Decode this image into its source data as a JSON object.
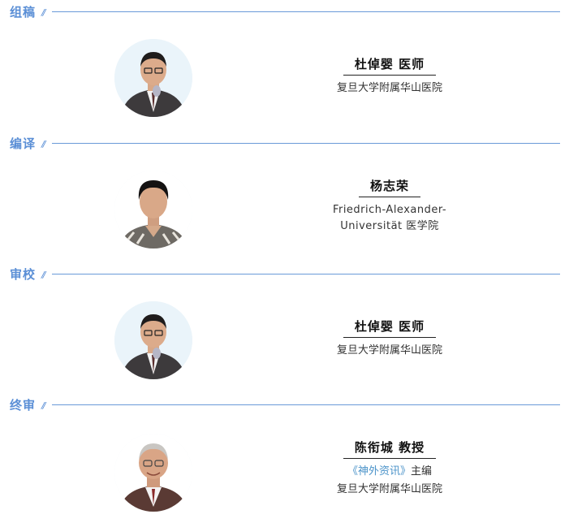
{
  "sections": [
    {
      "label": "组稿",
      "person": {
        "name": "杜倬婴 医师",
        "affiliation": "复旦大学附属华山医院"
      }
    },
    {
      "label": "编译",
      "person": {
        "name": "杨志荣",
        "affiliation_line1": "Friedrich-Alexander-",
        "affiliation_line2": "Universität 医学院"
      }
    },
    {
      "label": "审校",
      "person": {
        "name": "杜倬婴 医师",
        "affiliation": "复旦大学附属华山医院"
      }
    },
    {
      "label": "终审",
      "person": {
        "name": "陈衔城 教授",
        "publication": "《神外资讯》",
        "role": "主编",
        "affiliation": "复旦大学附属华山医院"
      }
    }
  ],
  "colors": {
    "accent": "#5b8fd6",
    "highlight": "#4b93c9",
    "divider": "#6a9ad8"
  }
}
